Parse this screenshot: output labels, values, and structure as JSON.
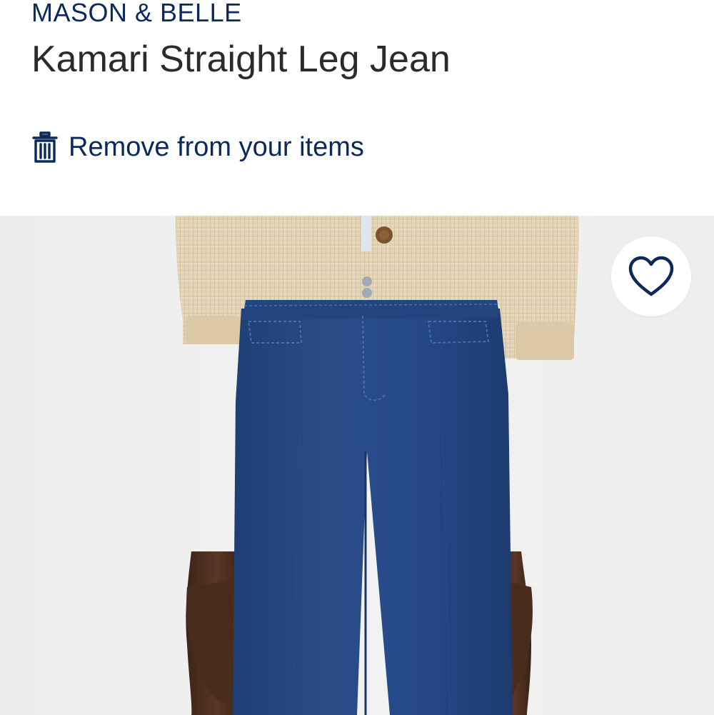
{
  "product": {
    "brand": "MASON & BELLE",
    "name": "Kamari Straight Leg Jean"
  },
  "actions": {
    "remove_label": "Remove from your items",
    "remove_icon": "trash-icon",
    "favorite_icon": "heart-icon"
  },
  "colors": {
    "brand_navy": "#0b2a5b",
    "title_text": "#2b2b2b",
    "photo_background": "#efefef",
    "denim": "#24477f",
    "sweater": "#e4d6bd"
  }
}
